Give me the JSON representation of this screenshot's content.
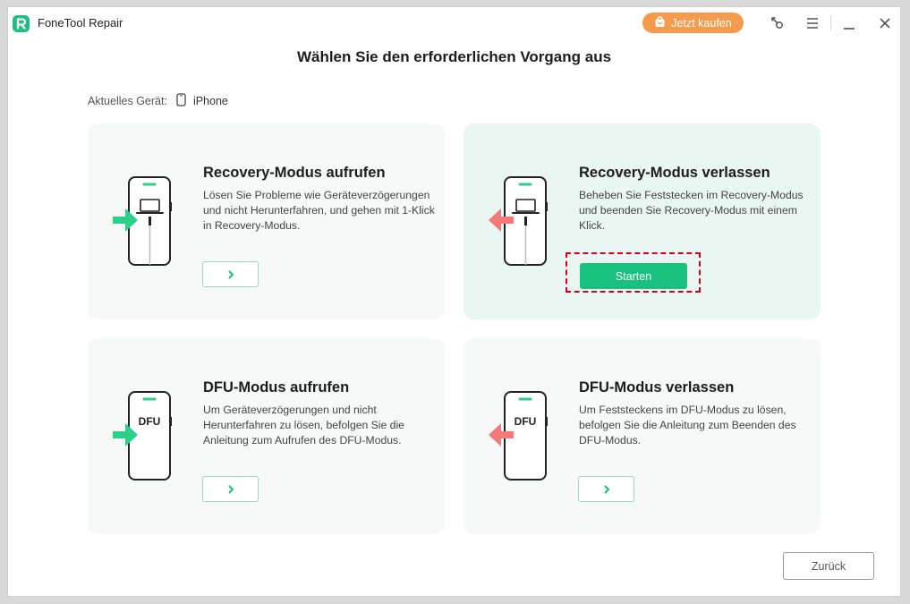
{
  "app": {
    "title": "FoneTool Repair",
    "buy_label": "Jetzt kaufen"
  },
  "heading": "Wählen Sie den erforderlichen Vorgang aus",
  "device": {
    "label": "Aktuelles Gerät:",
    "value": "iPhone"
  },
  "cards": [
    {
      "title": "Recovery-Modus aufrufen",
      "desc": "Lösen Sie Probleme wie Geräteverzögerungen und nicht Herunterfahren, und gehen mit 1-Klick in Recovery-Modus."
    },
    {
      "title": "Recovery-Modus verlassen",
      "desc": "Beheben Sie Feststecken im Recovery-Modus und beenden Sie Recovery-Modus mit einem Klick.",
      "button_label": "Starten"
    },
    {
      "title": "DFU-Modus aufrufen",
      "desc": "Um Geräteverzögerungen und nicht Herunterfahren zu lösen, befolgen Sie die Anleitung zum Aufrufen des DFU-Modus.",
      "phone_text": "DFU"
    },
    {
      "title": "DFU-Modus verlassen",
      "desc": "Um Feststeckens im DFU-Modus zu lösen, befolgen Sie die Anleitung zum Beenden des DFU-Modus.",
      "phone_text": "DFU"
    }
  ],
  "back_label": "Zurück",
  "colors": {
    "accent": "#19c17e",
    "enter_arrow": "#2ecf8a",
    "exit_arrow": "#f47a7a",
    "buy": "#f59b4e",
    "highlight": "#d9001b"
  },
  "icons": [
    "app-logo",
    "cart-icon",
    "key-icon",
    "menu-icon",
    "minimize-icon",
    "close-icon",
    "phone-icon",
    "laptop-icon",
    "arrow-right-icon",
    "arrow-left-icon",
    "chevron-right-icon"
  ]
}
